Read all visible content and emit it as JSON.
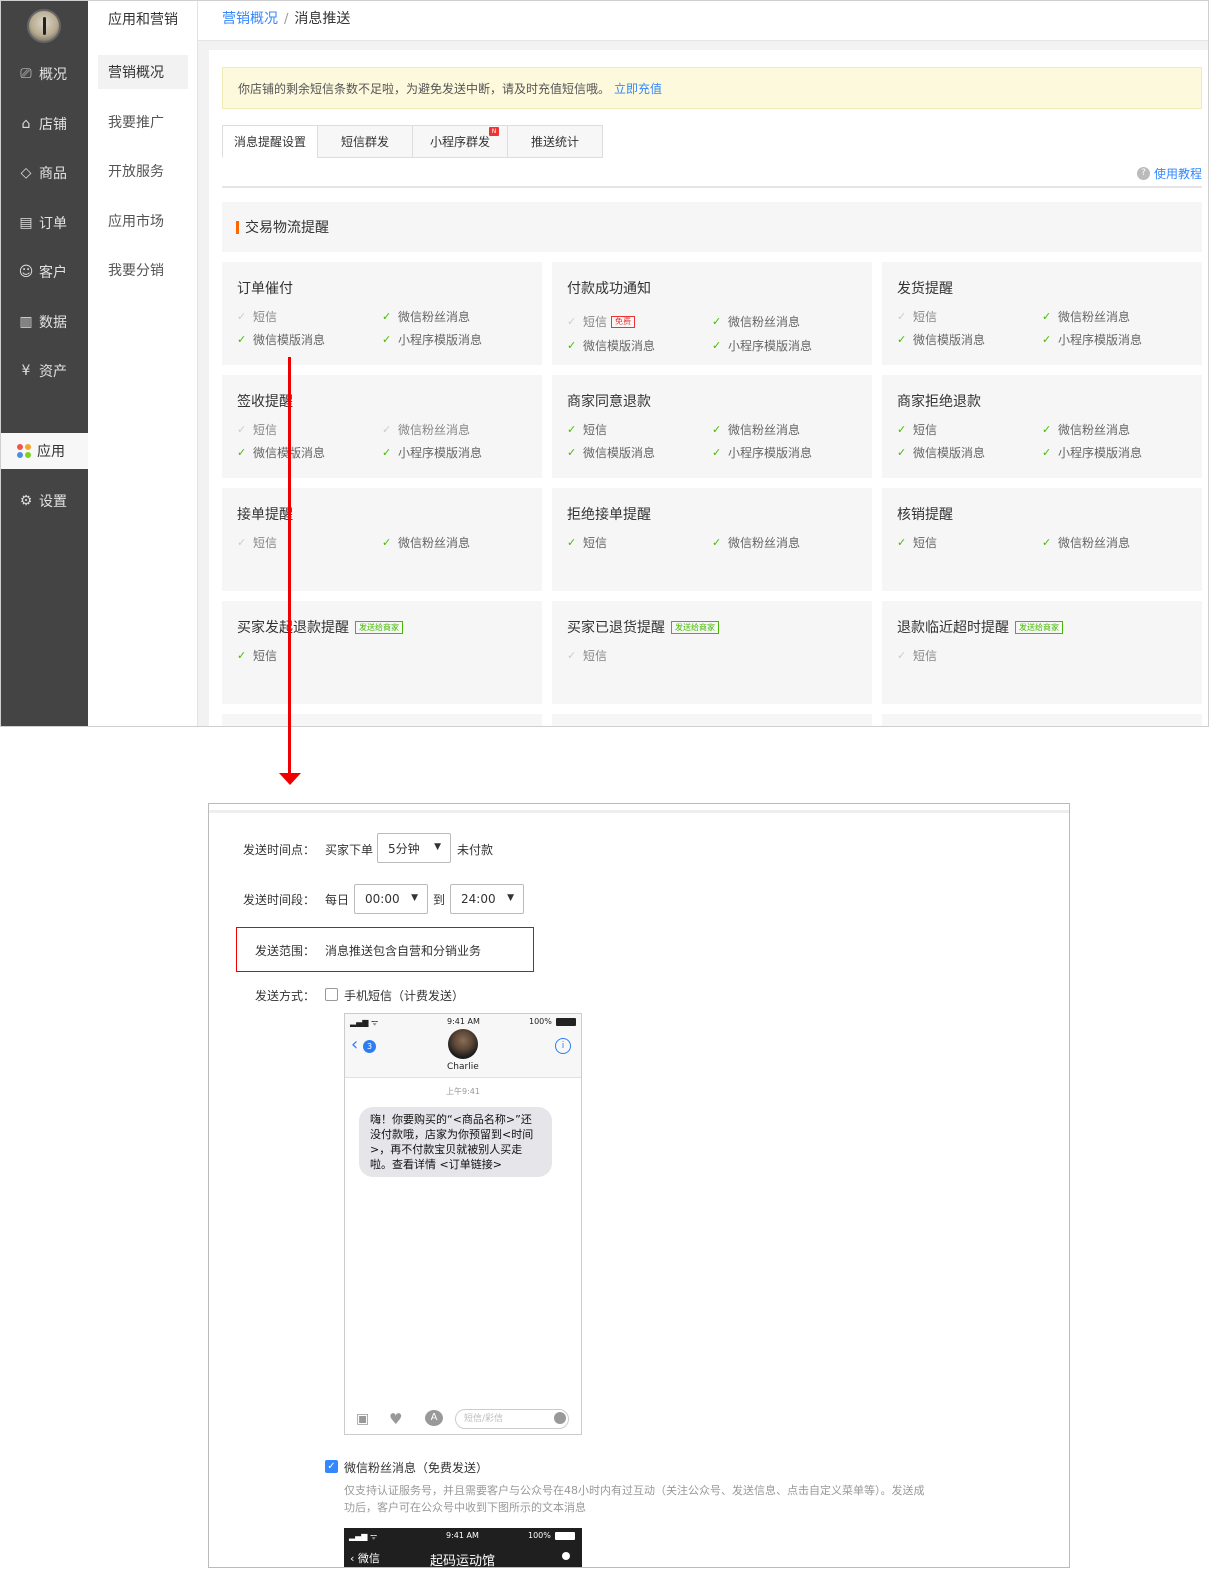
{
  "sidebar": {
    "items": [
      {
        "icon": "monitor-icon",
        "glyph": "⎚",
        "label": "概况"
      },
      {
        "icon": "store-icon",
        "glyph": "⌂",
        "label": "店铺"
      },
      {
        "icon": "tag-icon",
        "glyph": "◇",
        "label": "商品"
      },
      {
        "icon": "order-icon",
        "glyph": "▤",
        "label": "订单"
      },
      {
        "icon": "user-icon",
        "glyph": "☺",
        "label": "客户"
      },
      {
        "icon": "chart-icon",
        "glyph": "▥",
        "label": "数据"
      },
      {
        "icon": "yen-icon",
        "glyph": "¥",
        "label": "资产"
      },
      {
        "icon": "apps-icon",
        "glyph": "",
        "label": "应用"
      },
      {
        "icon": "gear-icon",
        "glyph": "⚙",
        "label": "设置"
      }
    ],
    "app_colors": [
      "#f2554a",
      "#f5a623",
      "#4a90e2",
      "#7ed321"
    ]
  },
  "subnav": {
    "title": "应用和营销",
    "items": [
      "营销概况",
      "我要推广",
      "开放服务",
      "应用市场",
      "我要分销"
    ]
  },
  "breadcrumb": {
    "link": "营销概况",
    "sep": "/",
    "current": "消息推送"
  },
  "notice": {
    "text": "你店铺的剩余短信条数不足啦，为避免发送中断，请及时充值短信哦。",
    "link": "立即充值"
  },
  "tabs": [
    "消息提醒设置",
    "短信群发",
    "小程序群发",
    "推送统计"
  ],
  "tab_new_badge": "N",
  "help": {
    "icon": "question-icon",
    "glyph": "?",
    "label": "使用教程"
  },
  "section": {
    "title": "交易物流提醒"
  },
  "cards": [
    {
      "title": "订单催付",
      "o1": "短信",
      "o2": "微信粉丝消息",
      "o3": "微信模版消息",
      "o4": "小程序模版消息"
    },
    {
      "title": "付款成功通知",
      "o1": "短信",
      "o1_badge": "免费",
      "o2": "微信粉丝消息",
      "o3": "微信模版消息",
      "o4": "小程序模版消息"
    },
    {
      "title": "发货提醒",
      "o1": "短信",
      "o2": "微信粉丝消息",
      "o3": "微信模版消息",
      "o4": "小程序模版消息"
    },
    {
      "title": "签收提醒",
      "o1": "短信",
      "o2": "微信粉丝消息",
      "o3": "微信模版消息",
      "o4": "小程序模版消息"
    },
    {
      "title": "商家同意退款",
      "o1": "短信",
      "o2": "微信粉丝消息",
      "o3": "微信模版消息",
      "o4": "小程序模版消息"
    },
    {
      "title": "商家拒绝退款",
      "o1": "短信",
      "o2": "微信粉丝消息",
      "o3": "微信模版消息",
      "o4": "小程序模版消息"
    },
    {
      "title": "接单提醒",
      "o1": "短信",
      "o2": "微信粉丝消息"
    },
    {
      "title": "拒绝接单提醒",
      "o1": "短信",
      "o2": "微信粉丝消息"
    },
    {
      "title": "核销提醒",
      "o1": "短信",
      "o2": "微信粉丝消息"
    },
    {
      "title": "买家发起退款提醒",
      "badge": "发送给商家",
      "o1": "短信"
    },
    {
      "title": "买家已退货提醒",
      "badge": "发送给商家",
      "o1": "短信"
    },
    {
      "title": "退款临近超时提醒",
      "badge": "发送给商家",
      "o1": "短信"
    }
  ],
  "check_glyph": "✓",
  "detail": {
    "send_time": {
      "label": "发送时间点：",
      "prefix": "买家下单",
      "value": "5分钟",
      "suffix": "未付款"
    },
    "send_period": {
      "label": "发送时间段：",
      "prefix": "每日",
      "from": "00:00",
      "to_label": "到",
      "to": "24:00"
    },
    "scope": {
      "label": "发送范围：",
      "value": "消息推送包含自营和分销业务"
    },
    "method": {
      "label": "发送方式：",
      "sms": "手机短信（计费发送）",
      "wechat": "微信粉丝消息（免费发送）",
      "wechat_desc_1": "仅支持认证服务号，并且需要客户与公众号在48小时内有过互动（关注公众号、发送信息、点击自定义菜单等）。发送成",
      "wechat_desc_2": "功后，客户可在公众号中收到下图所示的文本消息"
    },
    "dropdown_glyph": "▼",
    "phone": {
      "signal": "▂▄▆ ᯤ",
      "time": "9:41 AM",
      "battery": "100%",
      "back_count": "3",
      "contact": "Charlie",
      "msg_time": "上午9:41",
      "message": "嗨！你要购买的“<商品名称>”还没付款哦，店家为你预留到<时间>，再不付款宝贝就被别人买走啦。查看详情 <订单链接>",
      "input_placeholder": "短信/彩信"
    },
    "phone2": {
      "signal": "▂▄▆ ᯤ",
      "time": "9:41 AM",
      "battery": "100%",
      "back": "微信",
      "title": "起码运动馆"
    }
  }
}
